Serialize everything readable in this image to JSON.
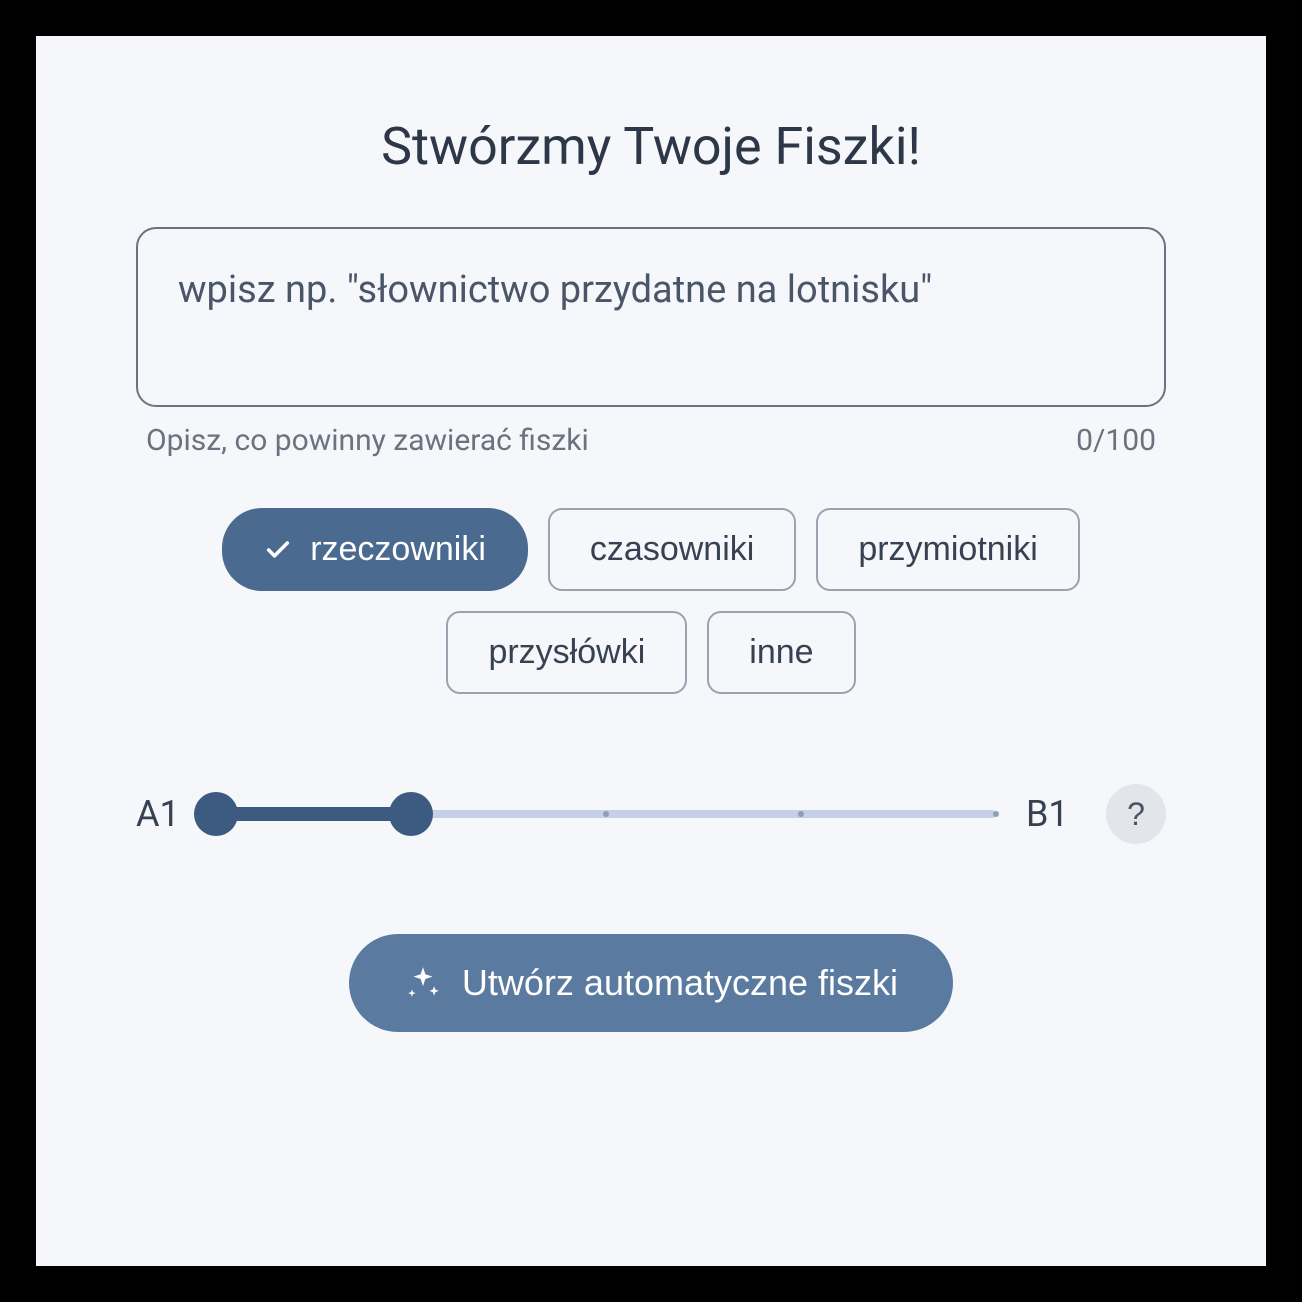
{
  "title": "Stwórzmy Twoje Fiszki!",
  "input": {
    "placeholder": "wpisz np. \"słownictwo przydatne na lotnisku\"",
    "helper": "Opisz, co powinny zawierać fiszki",
    "counter": "0/100"
  },
  "chips": [
    {
      "label": "rzeczowniki",
      "selected": true
    },
    {
      "label": "czasowniki",
      "selected": false
    },
    {
      "label": "przymiotniki",
      "selected": false
    },
    {
      "label": "przysłówki",
      "selected": false
    },
    {
      "label": "inne",
      "selected": false
    }
  ],
  "slider": {
    "min_label": "A1",
    "max_label": "B1"
  },
  "help_icon": "?",
  "create_button": "Utwórz automatyczne fiszki",
  "colors": {
    "accent": "#4a6a8f",
    "accent_light": "#5a7a9f",
    "slider_fill": "#3d5a80"
  }
}
